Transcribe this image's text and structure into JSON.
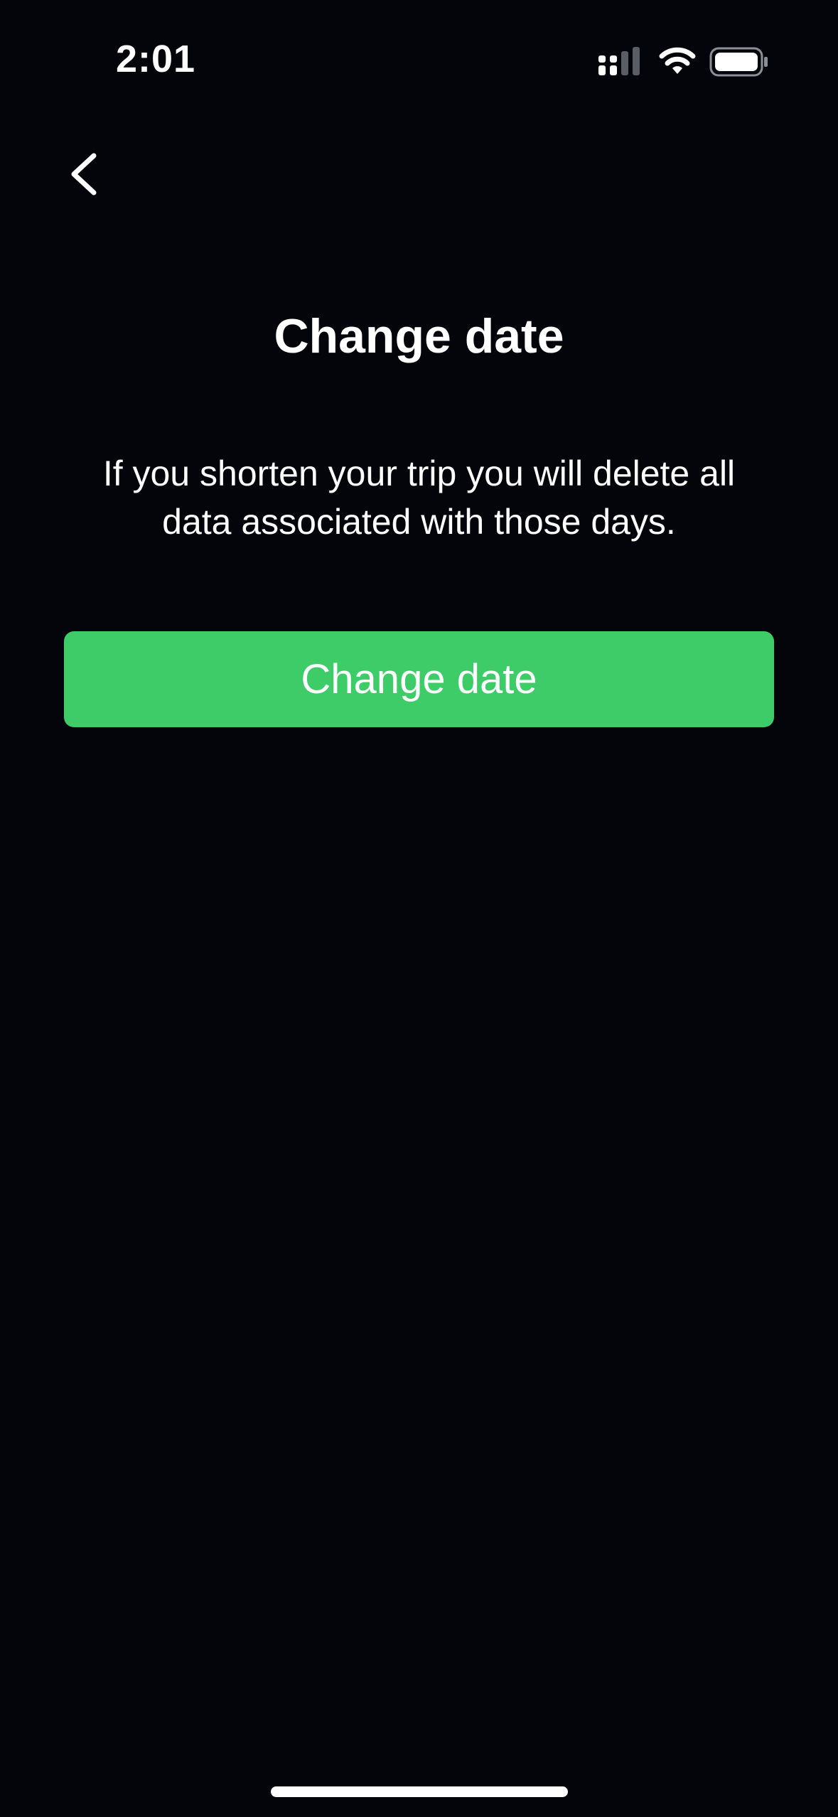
{
  "status_bar": {
    "time": "2:01",
    "signal_icon": "cellular-signal-icon",
    "wifi_icon": "wifi-icon",
    "battery_icon": "battery-icon"
  },
  "nav": {
    "back_icon": "chevron-left-icon"
  },
  "main": {
    "title": "Change date",
    "description": "If you shorten your trip you will delete all data associated with those days.",
    "button_label": "Change date"
  },
  "colors": {
    "background": "#03050b",
    "accent": "#3ecc68",
    "text": "#ffffff"
  }
}
